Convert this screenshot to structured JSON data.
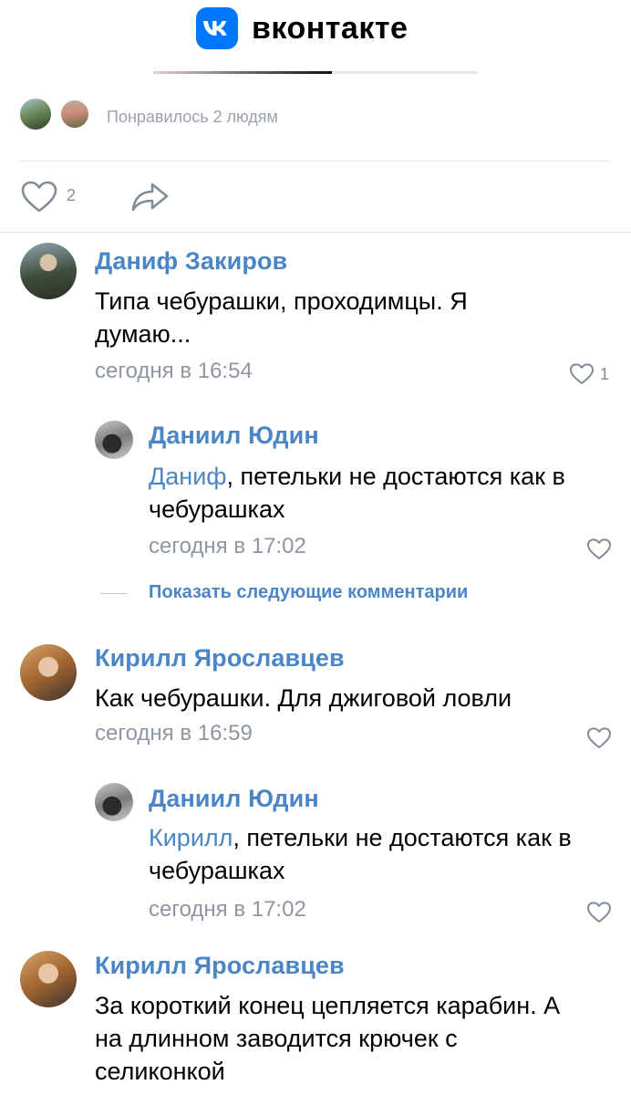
{
  "header": {
    "brand": "вконтакте",
    "logo_icon": "vk-logo-icon",
    "accent_color": "#0077ff",
    "progress": 0.55
  },
  "likes": {
    "text": "Понравилось 2 людям",
    "count": "2"
  },
  "comments": [
    {
      "author": "Даниф Закиров",
      "text": "Типа чебурашки, проходимцы. Я думаю...",
      "time": "сегодня в 16:54",
      "likes": "1"
    },
    {
      "author": "Даниил Юдин",
      "mention": "Даниф",
      "text": ", петельки не достаются как в чебурашках",
      "time": "сегодня в 17:02"
    },
    {
      "author": "Кирилл Ярославцев",
      "text": "Как чебурашки. Для джиговой ловли",
      "time": "сегодня в 16:59"
    },
    {
      "author": "Даниил Юдин",
      "mention": "Кирилл",
      "text": ", петельки не достаются как в чебурашках",
      "time": "сегодня в 17:02"
    },
    {
      "author": "Кирилл Ярославцев",
      "text": "За короткий конец цепляется карабин. А на длинном заводится крючек с селиконкой"
    }
  ],
  "show_more": "Показать следующие комментарии",
  "colors": {
    "link": "#4a86c5",
    "muted": "#8d96a1"
  }
}
